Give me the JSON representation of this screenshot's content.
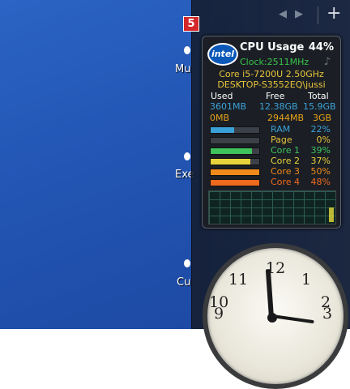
{
  "desktop": {
    "icons": [
      {
        "label": "Mu"
      },
      {
        "label": "Exe"
      },
      {
        "label": "Cu"
      }
    ]
  },
  "sidebar": {
    "nav": {
      "prev_icon": "◀",
      "next_icon": "▶",
      "add_label": "+"
    },
    "badge": "5"
  },
  "cpu_gadget": {
    "logo_text": "intel",
    "title": "CPU Usage",
    "usage_percent": "44%",
    "clock_label": "Clock:2511MHz",
    "cpu_model": "Core i5-7200U 2.50GHz",
    "hostname": "DESKTOP-S3552EQ\\jussi",
    "memory_headers": {
      "used": "Used",
      "free": "Free",
      "total": "Total"
    },
    "ram_row": {
      "used": "3601MB",
      "free": "12.38GB",
      "total": "15.9GB"
    },
    "page_row": {
      "used": "0MB",
      "free": "2944MB",
      "total": "3GB"
    },
    "meters": [
      {
        "label": "RAM",
        "value": "22%",
        "fraction": 0.22,
        "color": "#3aa1d8"
      },
      {
        "label": "Page",
        "value": "0%",
        "fraction": 0.0,
        "color": "#e6c23a"
      },
      {
        "label": "Core 1",
        "value": "39%",
        "fraction": 0.39,
        "color": "#3fc25c"
      },
      {
        "label": "Core 2",
        "value": "37%",
        "fraction": 0.37,
        "color": "#e6d23a"
      },
      {
        "label": "Core 3",
        "value": "50%",
        "fraction": 0.5,
        "color": "#f08a1a"
      },
      {
        "label": "Core 4",
        "value": "48%",
        "fraction": 0.48,
        "color": "#ef6a1f"
      }
    ],
    "colors": {
      "used_text": "#3aa1d8",
      "page_text": "#e6a21a"
    }
  },
  "clock_gadget": {
    "numerals": [
      "12",
      "1",
      "11",
      "2",
      "10",
      "3",
      "9"
    ]
  }
}
